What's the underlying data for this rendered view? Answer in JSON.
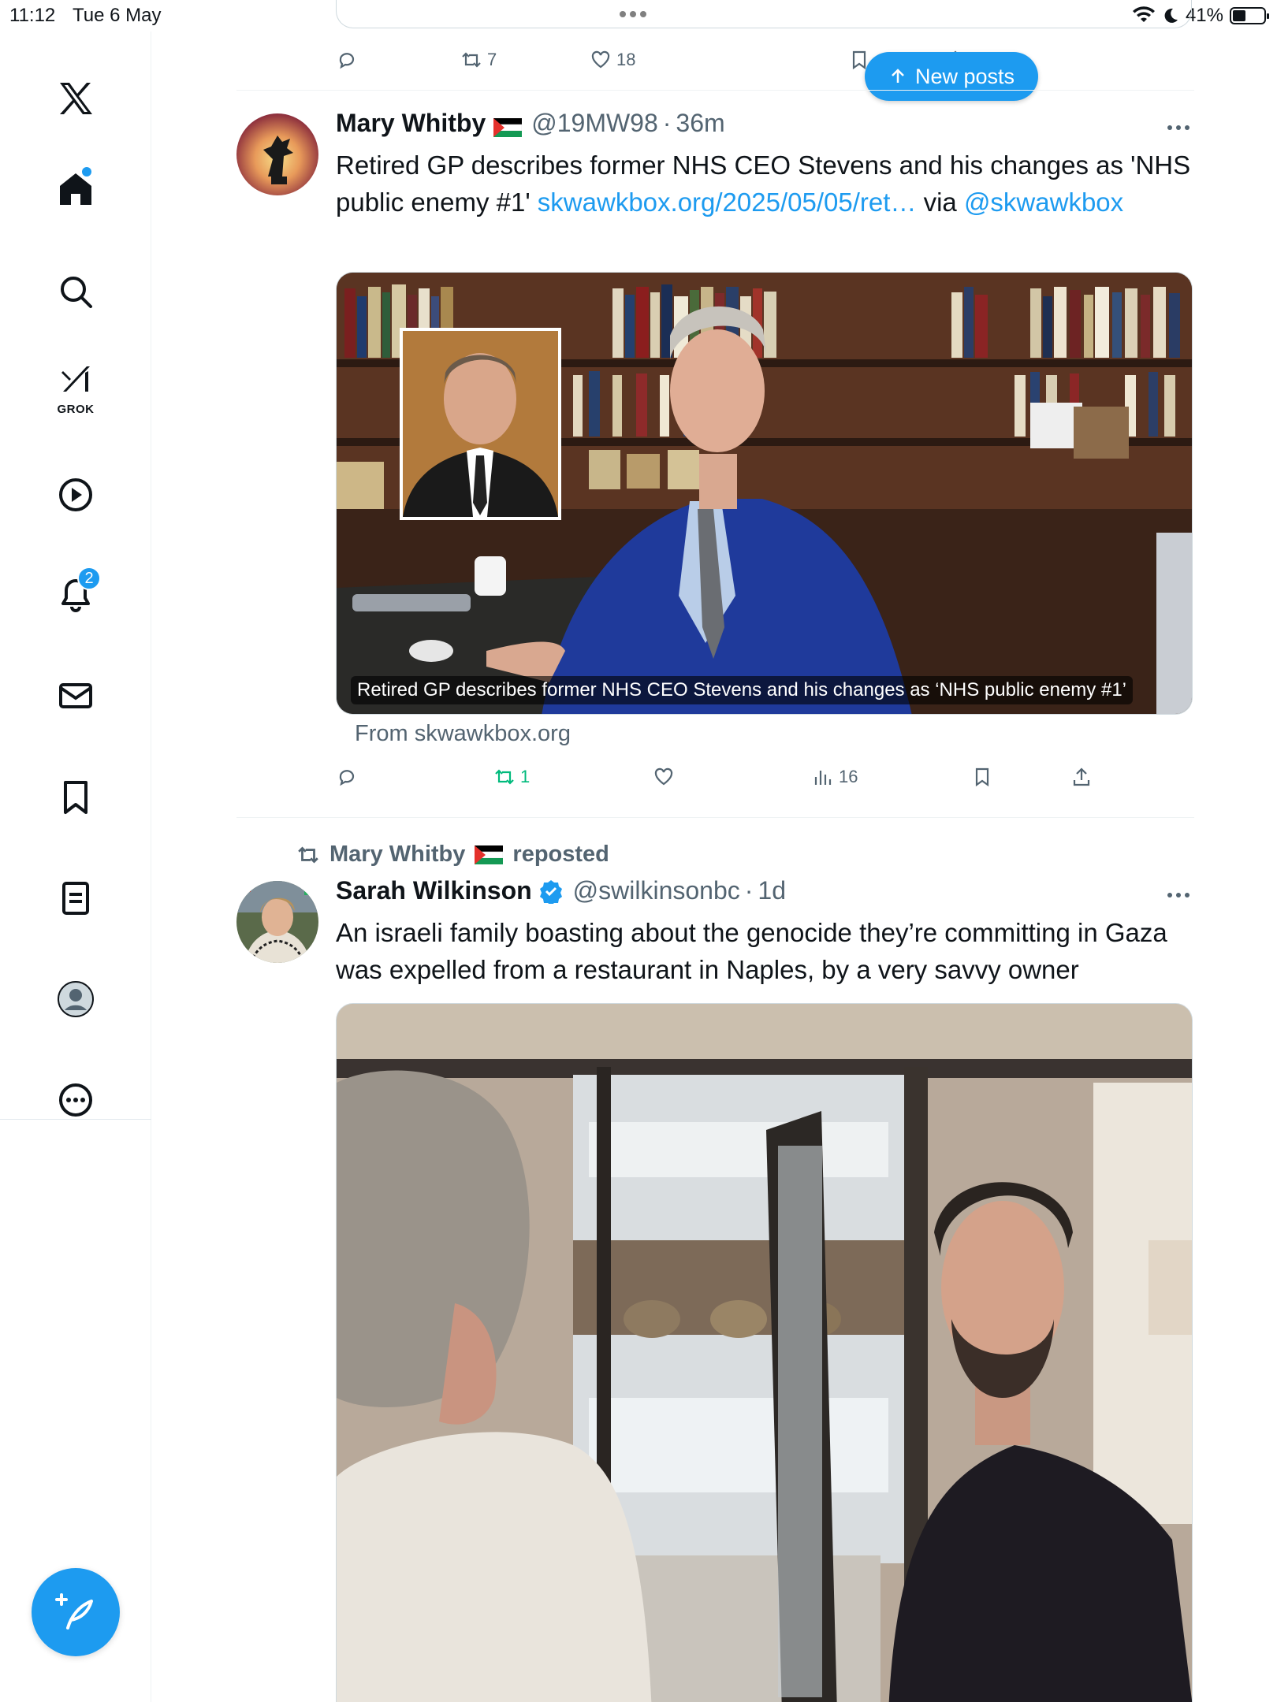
{
  "status_bar": {
    "time": "11:12",
    "date": "Tue 6 May",
    "battery": "41%"
  },
  "sidebar": {
    "grok_label": "GROK",
    "notifications_badge": "2"
  },
  "prev_tweet": {
    "retweets": "7",
    "likes": "18"
  },
  "new_posts_label": "New posts",
  "tweet1": {
    "name": "Mary Whitby",
    "handle": "@19MW98",
    "time": "36m",
    "text_1": "Retired GP describes former NHS CEO Stevens and his changes as 'NHS public enemy #1' ",
    "link": "skwawkbox.org/2025/05/05/ret…",
    "text_2": " via ",
    "mention": "@skwawkbox",
    "media_caption": "Retired GP describes former NHS CEO Stevens and his changes as ‘NHS public enemy #1’",
    "from": "From skwawkbox.org",
    "retweets": "1",
    "views": "16"
  },
  "tweet2": {
    "reposted_by": "Mary Whitby",
    "reposted_label": "reposted",
    "name": "Sarah Wilkinson",
    "handle": "@swilkinsonbc",
    "time": "1d",
    "text": "An israeli family boasting about the genocide they’re committing in Gaza was expelled from a restaurant in Naples, by a very savvy owner"
  },
  "colors": {
    "accent": "#1d9bf0",
    "repost_green": "#00ba7c",
    "secondary_text": "#536471"
  }
}
